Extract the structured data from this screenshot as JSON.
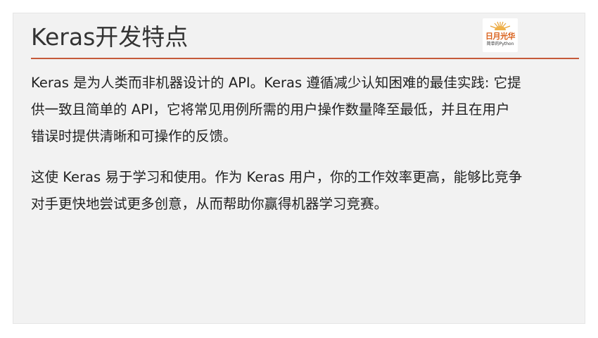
{
  "slide": {
    "title": "Keras开发特点",
    "logo": {
      "main_text": "日月光华",
      "sub_text": "简单的Python"
    },
    "paragraphs": [
      {
        "lines": [
          "Keras 是为人类而非机器设计的 API。Keras 遵循减少认知困难的最佳实践: 它提",
          "供一致且简单的 API，它将常见用例所需的用户操作数量降至最低，并且在用户",
          "错误时提供清晰和可操作的反馈。"
        ]
      },
      {
        "lines": [
          "这使 Keras 易于学习和使用。作为 Keras 用户，你的工作效率更高，能够比竞争",
          "对手更快地尝试更多创意，从而帮助你赢得机器学习竞赛。"
        ]
      }
    ]
  },
  "colors": {
    "title_rule": "#c55a3a",
    "logo_accent": "#d9601a",
    "slide_background": "#f2f2f2"
  }
}
